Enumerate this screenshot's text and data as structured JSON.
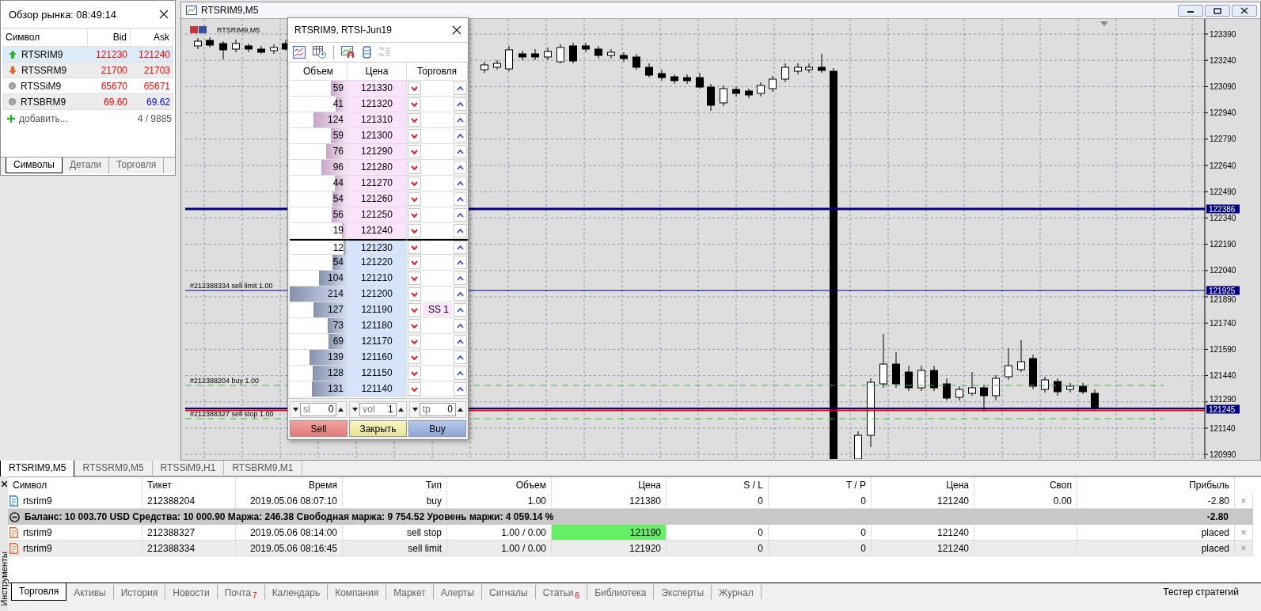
{
  "market_watch": {
    "title": "Обзор рынка: 08:49:14",
    "columns": [
      "Символ",
      "Bid",
      "Ask"
    ],
    "rows": [
      {
        "symbol": "RTSRIM9",
        "kind": "up",
        "bid": "121230",
        "ask": "121240",
        "bid_rising": false,
        "ask_rising": false,
        "selected": true
      },
      {
        "symbol": "RTSSRM9",
        "kind": "down",
        "bid": "21700",
        "ask": "21703",
        "bid_rising": false,
        "ask_rising": false,
        "selected": false
      },
      {
        "symbol": "RTSSiM9",
        "kind": "none",
        "bid": "65670",
        "ask": "65671",
        "bid_rising": false,
        "ask_rising": false,
        "selected": false
      },
      {
        "symbol": "RTSBRM9",
        "kind": "none",
        "bid": "69.60",
        "ask": "69.62",
        "bid_rising": false,
        "ask_rising": true,
        "selected": false
      }
    ],
    "add_label": "добавить...",
    "count": "4 / 9885",
    "tabs": [
      {
        "label": "Символы",
        "selected": true
      },
      {
        "label": "Детали",
        "selected": false
      },
      {
        "label": "Торговля",
        "selected": false
      }
    ]
  },
  "chart_window": {
    "title": "RTSRIM9,M5"
  },
  "chart": {
    "symbol_label": "RTSRIM9,M5",
    "price_axis_labels": [
      "123390",
      "123240",
      "123090",
      "122940",
      "122790",
      "122640",
      "122490",
      "122340",
      "122190",
      "122040",
      "121890",
      "121740",
      "121590",
      "121440",
      "121290",
      "121140",
      "120990"
    ],
    "price_tags": [
      "122386",
      "121925",
      "121245"
    ],
    "order_labels": [
      "#212388334 sell limit 1.00",
      "#212388204 buy 1.00",
      "#212388327 sell stop 1.00"
    ]
  },
  "depth_of_market": {
    "title": "RTSRIM9, RTSI-Jun19",
    "columns": [
      "Объем",
      "Цена",
      "Торговля"
    ],
    "rows": [
      {
        "kind": "ask",
        "volume": "59",
        "price": "121330",
        "level": 0.28
      },
      {
        "kind": "ask",
        "volume": "41",
        "price": "121320",
        "level": 0.19
      },
      {
        "kind": "ask",
        "volume": "124",
        "price": "121310",
        "level": 0.58
      },
      {
        "kind": "ask",
        "volume": "59",
        "price": "121300",
        "level": 0.28
      },
      {
        "kind": "ask",
        "volume": "76",
        "price": "121290",
        "level": 0.36
      },
      {
        "kind": "ask",
        "volume": "96",
        "price": "121280",
        "level": 0.45
      },
      {
        "kind": "ask",
        "volume": "44",
        "price": "121270",
        "level": 0.21
      },
      {
        "kind": "ask",
        "volume": "54",
        "price": "121260",
        "level": 0.25
      },
      {
        "kind": "ask",
        "volume": "56",
        "price": "121250",
        "level": 0.26
      },
      {
        "kind": "ask",
        "volume": "19",
        "price": "121240",
        "level": 0.09
      },
      {
        "kind": "bid",
        "volume": "12",
        "price": "121230",
        "level": 0.06
      },
      {
        "kind": "bid",
        "volume": "54",
        "price": "121220",
        "level": 0.25
      },
      {
        "kind": "bid",
        "volume": "104",
        "price": "121210",
        "level": 0.49
      },
      {
        "kind": "bid",
        "volume": "214",
        "price": "121200",
        "level": 1
      },
      {
        "kind": "bid",
        "volume": "127",
        "price": "121190",
        "level": 0.59,
        "order": "SS 1"
      },
      {
        "kind": "bid",
        "volume": "73",
        "price": "121180",
        "level": 0.34
      },
      {
        "kind": "bid",
        "volume": "69",
        "price": "121170",
        "level": 0.32
      },
      {
        "kind": "bid",
        "volume": "139",
        "price": "121160",
        "level": 0.65
      },
      {
        "kind": "bid",
        "volume": "128",
        "price": "121150",
        "level": 0.6
      },
      {
        "kind": "bid",
        "volume": "131",
        "price": "121140",
        "level": 0.61
      }
    ],
    "spinners": [
      {
        "label": "sl",
        "value": "0"
      },
      {
        "label": "vol",
        "value": "1"
      },
      {
        "label": "tp",
        "value": "0"
      }
    ],
    "buttons": [
      {
        "label": "Sell",
        "kind": "sell"
      },
      {
        "label": "Закрыть",
        "kind": "close"
      },
      {
        "label": "Buy",
        "kind": "buy"
      }
    ]
  },
  "chart_tabs": [
    {
      "label": "RTSRIM9,M5",
      "selected": true
    },
    {
      "label": "RTSSRM9,M5",
      "selected": false
    },
    {
      "label": "RTSSiM9,H1",
      "selected": false
    },
    {
      "label": "RTSBRM9,M1",
      "selected": false
    }
  ],
  "toolbox": {
    "side_label": "Инструменты",
    "columns": [
      "Символ",
      "Тикет",
      "Время",
      "Тип",
      "Объем",
      "Цена",
      "S / L",
      "T / P",
      "Цена",
      "Своп",
      "Прибыль"
    ],
    "rows": [
      {
        "kind": "position",
        "cells": [
          "rtsrim9",
          "212388204",
          "2019.05.06 08:07:10",
          "buy",
          "1.00",
          "121380",
          "0",
          "0",
          "121240",
          "0.00",
          "-2.80"
        ],
        "price_highlighted": false,
        "close": "×"
      },
      {
        "kind": "summary",
        "text": "Баланс: 10 003.70 USD  Средства: 10 000.90  Маржа: 246.38  Свободная маржа: 9 754.52  Уровень маржи: 4 059.14 %",
        "profit": "-2.80"
      },
      {
        "kind": "order",
        "cells": [
          "rtsrim9",
          "212388327",
          "2019.05.06 08:14:00",
          "sell stop",
          "1.00 / 0.00",
          "121190",
          "0",
          "0",
          "121240",
          "",
          "placed"
        ],
        "price_highlighted": true,
        "close": "×"
      },
      {
        "kind": "order",
        "cells": [
          "rtsrim9",
          "212388334",
          "2019.05.06 08:16:45",
          "sell limit",
          "1.00 / 0.00",
          "121920",
          "0",
          "0",
          "121240",
          "",
          "placed"
        ],
        "price_highlighted": false,
        "close": "×"
      }
    ],
    "tabs": [
      {
        "label": "Торговля",
        "selected": true
      },
      {
        "label": "Активы",
        "selected": false
      },
      {
        "label": "История",
        "selected": false
      },
      {
        "label": "Новости",
        "selected": false
      },
      {
        "label": "Почта",
        "badge": "7",
        "selected": false
      },
      {
        "label": "Календарь",
        "selected": false
      },
      {
        "label": "Компания",
        "selected": false
      },
      {
        "label": "Маркет",
        "selected": false
      },
      {
        "label": "Алерты",
        "selected": false
      },
      {
        "label": "Сигналы",
        "selected": false
      },
      {
        "label": "Статьи",
        "badge": "6",
        "selected": false
      },
      {
        "label": "Библиотека",
        "selected": false
      },
      {
        "label": "Эксперты",
        "selected": false
      },
      {
        "label": "Журнал",
        "selected": false
      }
    ],
    "strategy_tester": "Тестер стратегий"
  }
}
